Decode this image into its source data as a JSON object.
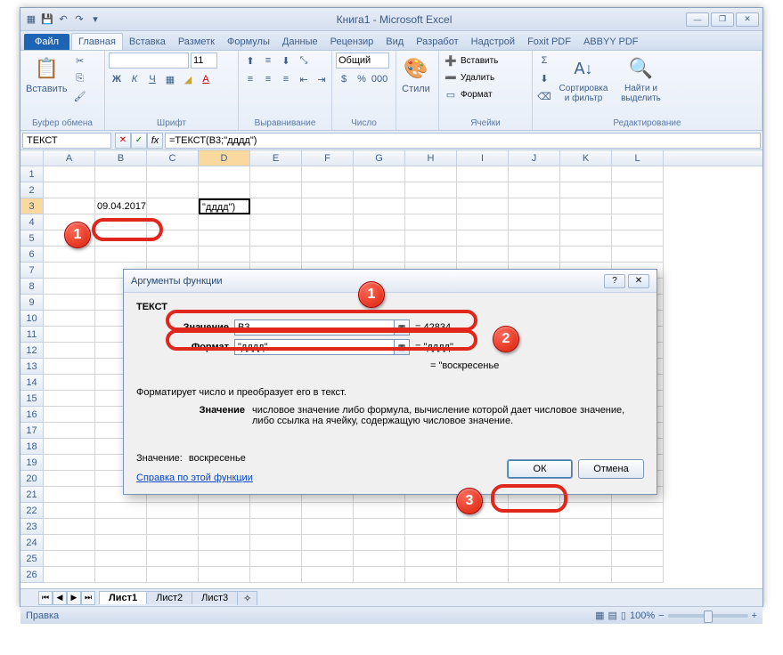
{
  "title": "Книга1 - Microsoft Excel",
  "tabs": {
    "file": "Файл",
    "list": [
      "Главная",
      "Вставка",
      "Разметк",
      "Формулы",
      "Данные",
      "Рецензир",
      "Вид",
      "Разработ",
      "Надстрой",
      "Foxit PDF",
      "ABBYY PDF"
    ],
    "active": 0
  },
  "ribbon": {
    "clipboard": {
      "label": "Буфер обмена",
      "paste": "Вставить"
    },
    "font": {
      "label": "Шрифт",
      "size": "11"
    },
    "align": {
      "label": "Выравнивание"
    },
    "number": {
      "label": "Число",
      "fmt": "Общий"
    },
    "styles": {
      "label": "Стили",
      "btn": "Стили"
    },
    "cells": {
      "label": "Ячейки",
      "insert": "Вставить",
      "delete": "Удалить",
      "format": "Формат"
    },
    "editing": {
      "label": "Редактирование",
      "sort": "Сортировка и фильтр",
      "find": "Найти и выделить"
    }
  },
  "namebox": "ТЕКСТ",
  "formula": "=ТЕКСТ(B3;\"дддд\")",
  "columns": [
    "A",
    "B",
    "C",
    "D",
    "E",
    "F",
    "G",
    "H",
    "I",
    "J",
    "K",
    "L"
  ],
  "cellB3": "09.04.2017",
  "cellD3": "\"дддд\")",
  "sheets": [
    "Лист1",
    "Лист2",
    "Лист3"
  ],
  "status": "Правка",
  "zoom": "100%",
  "dialog": {
    "title": "Аргументы функции",
    "fn": "ТЕКСТ",
    "arg1": {
      "label": "Значение",
      "value": "B3",
      "result": "= 42834"
    },
    "arg2": {
      "label": "Формат",
      "value": "\"дддд\"",
      "result": "= \"дддд\""
    },
    "fnresult": "= \"воскресенье",
    "desc": "Форматирует число и преобразует его в текст.",
    "argdesc_label": "Значение",
    "argdesc_text": "числовое значение либо формула, вычисление которой дает числовое значение, либо ссылка на ячейку, содержащую числовое значение.",
    "result_label": "Значение:",
    "result_value": "воскресенье",
    "help": "Справка по этой функции",
    "ok": "ОК",
    "cancel": "Отмена"
  },
  "markers": {
    "m1": "1",
    "d1": "1",
    "d2": "2",
    "d3": "3"
  }
}
